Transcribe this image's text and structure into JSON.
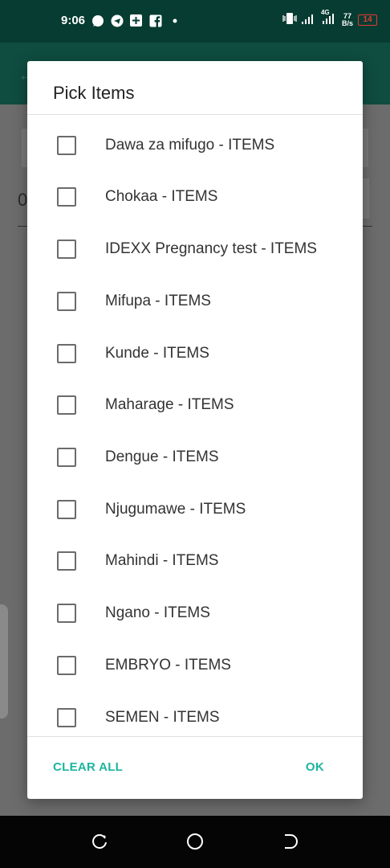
{
  "status_bar": {
    "time": "9:06",
    "net_speed_value": "77",
    "net_speed_unit": "B/s",
    "network_type": "4G",
    "battery": "14",
    "icons": [
      "whatsapp-icon",
      "telegram-icon",
      "add-box-icon",
      "facebook-icon",
      "dot-icon",
      "vibrate-icon",
      "signal-icon",
      "signal-4g-icon",
      "battery-icon"
    ]
  },
  "dialog": {
    "title": "Pick Items",
    "items": [
      {
        "label": "Dawa za mifugo - ITEMS",
        "checked": false
      },
      {
        "label": "Chokaa - ITEMS",
        "checked": false
      },
      {
        "label": "IDEXX Pregnancy test - ITEMS",
        "checked": false
      },
      {
        "label": "Mifupa - ITEMS",
        "checked": false
      },
      {
        "label": "Kunde - ITEMS",
        "checked": false
      },
      {
        "label": "Maharage - ITEMS",
        "checked": false
      },
      {
        "label": "Dengue - ITEMS",
        "checked": false
      },
      {
        "label": "Njugumawe - ITEMS",
        "checked": false
      },
      {
        "label": "Mahindi - ITEMS",
        "checked": false
      },
      {
        "label": "Ngano - ITEMS",
        "checked": false
      },
      {
        "label": "EMBRYO - ITEMS",
        "checked": false
      },
      {
        "label": "SEMEN - ITEMS",
        "checked": false
      }
    ],
    "clear_all_label": "CLEAR ALL",
    "ok_label": "OK"
  },
  "background": {
    "field_text": "0"
  },
  "colors": {
    "status_bar": "#063c31",
    "app_bar": "#0f4d40",
    "accent": "#1cb5a0",
    "nav_bar": "#050505"
  },
  "nav_bar": {
    "icons": [
      "recent-apps-icon",
      "home-icon",
      "back-icon"
    ]
  }
}
